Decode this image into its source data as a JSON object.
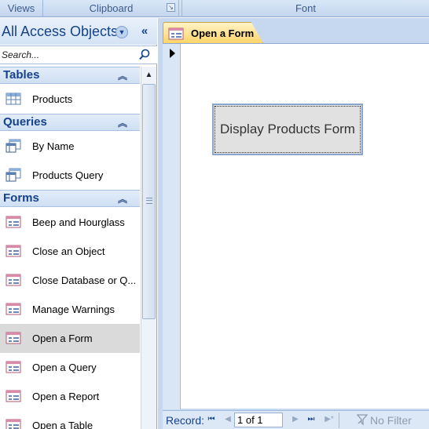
{
  "ribbon": {
    "groups": [
      "Views",
      "Clipboard",
      "Font"
    ]
  },
  "nav_pane": {
    "title": "All Access Objects",
    "search_placeholder": "Search...",
    "groups": [
      {
        "title": "Tables",
        "items": [
          "Products"
        ]
      },
      {
        "title": "Queries",
        "items": [
          "By Name",
          "Products Query"
        ]
      },
      {
        "title": "Forms",
        "items": [
          "Beep and Hourglass",
          "Close an Object",
          "Close Database or Q...",
          "Manage Warnings",
          "Open a Form",
          "Open a Query",
          "Open a Report",
          "Open a Table"
        ]
      }
    ],
    "selected_item": "Open a Form"
  },
  "document": {
    "tab_label": "Open a Form",
    "button_label": "Display Products Form"
  },
  "record_nav": {
    "label": "Record:",
    "current": "1 of 1",
    "filter_label": "No Filter"
  },
  "colors": {
    "accent": "#15428b",
    "tab_active": "#ffd46a",
    "pane_bg": "#c5d8ef"
  }
}
